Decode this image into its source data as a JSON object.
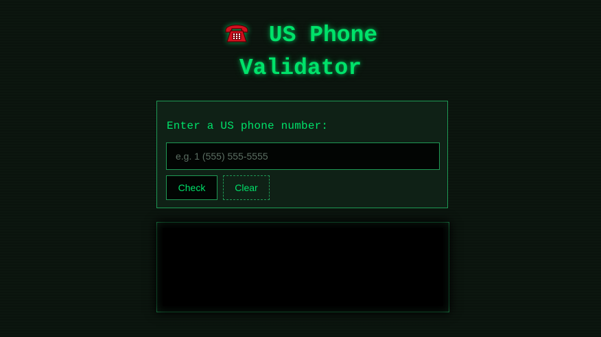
{
  "title": {
    "icon": "telephone-icon",
    "line1": "US Phone",
    "line2": "Validator"
  },
  "form": {
    "prompt": "Enter a US phone number:",
    "input_value": "",
    "input_placeholder": "e.g. 1 (555) 555-5555",
    "check_label": "Check",
    "clear_label": "Clear"
  },
  "results": {
    "text": ""
  },
  "colors": {
    "accent": "#00e26a",
    "border": "#1f9a55",
    "background": "#0c160f",
    "icon": "#d0101e"
  }
}
